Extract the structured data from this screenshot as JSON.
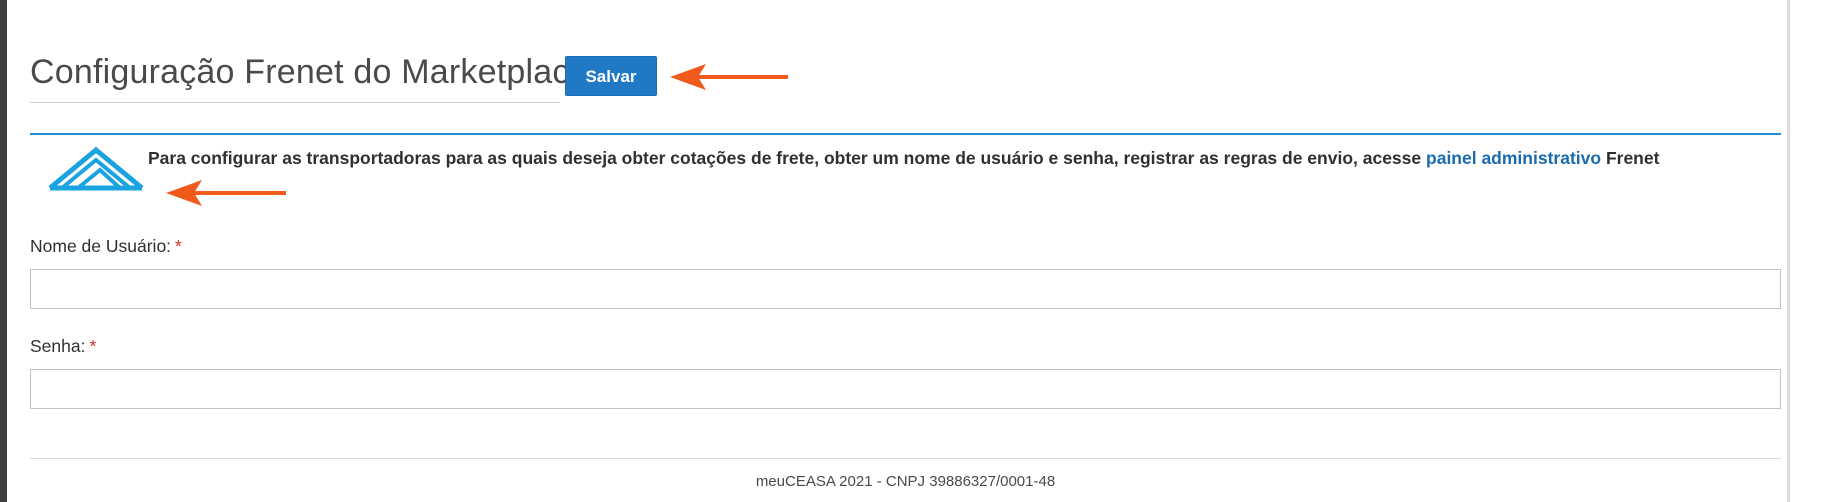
{
  "header": {
    "title": "Configuração Frenet do Marketplace",
    "save_label": "Salvar"
  },
  "info": {
    "text": "Para configurar as transportadoras para as quais deseja obter cotações de frete, obter um nome de usuário e senha, registrar as regras de envio, acesse",
    "link_text": "painel administrativo",
    "suffix": "Frenet",
    "logo_icon": "frenet-logo-icon"
  },
  "form": {
    "username": {
      "label": "Nome de Usuário:",
      "required_mark": "*",
      "value": "",
      "placeholder": ""
    },
    "password": {
      "label": "Senha:",
      "required_mark": "*",
      "value": "",
      "placeholder": ""
    }
  },
  "annotations": {
    "arrow_icon": "arrow-left-icon",
    "arrow_color": "#f05a1a"
  },
  "footer": {
    "text": "meuCEASA 2021 - CNPJ 39886327/0001-48"
  },
  "colors": {
    "accent": "#1f79c4",
    "rule": "#1d8fd6",
    "required": "#e02b27",
    "link": "#1a6bb0"
  }
}
